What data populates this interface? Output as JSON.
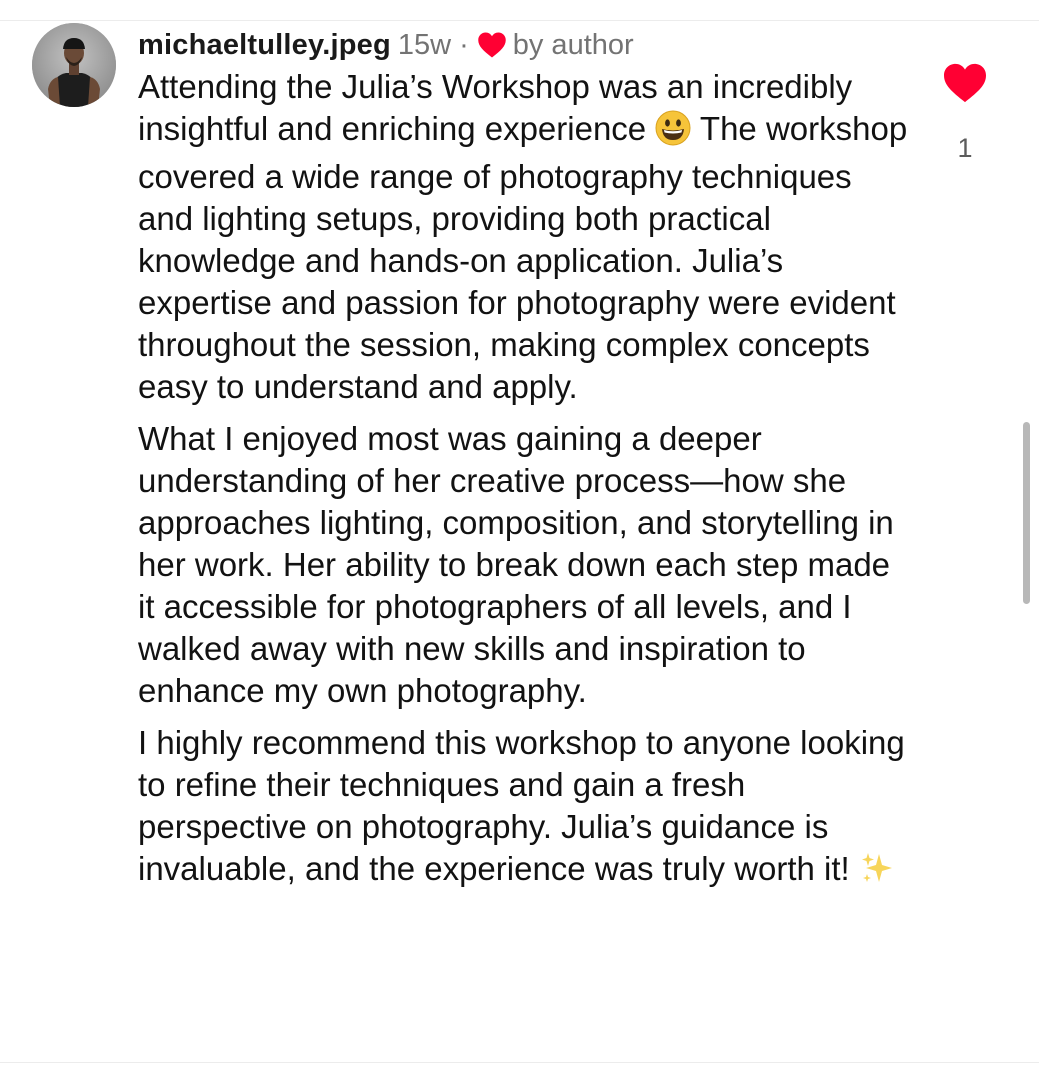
{
  "comment": {
    "username": "michaeltulley.jpeg",
    "timestamp": "15w",
    "separator": "·",
    "author_badge": "by author",
    "paragraphs": [
      {
        "before_emoji": "Attending the Julia’s Workshop was an incredibly insightful and enriching experience",
        "emoji": "grinning-face-emoji",
        "after_emoji": "The workshop covered a wide range of photography techniques and lighting setups, providing both practical knowledge and hands-on application. Julia’s expertise and passion for photography were evident throughout the session, making complex concepts easy to understand and apply."
      },
      {
        "text": "What I enjoyed most was gaining a deeper understanding of her creative process—how she approaches lighting, composition, and storytelling in her work. Her ability to break down each step made it accessible for photographers of all levels, and I walked away with new skills and inspiration to enhance my own photography."
      },
      {
        "text": "I highly recommend this workshop to anyone looking to refine their techniques and gain a fresh perspective on photography. Julia’s guidance is invaluable, and the experience was truly worth it!",
        "emoji": "sparkles-emoji"
      }
    ],
    "like_count": "1",
    "liked": true
  },
  "icons": {
    "author_heart": "heart-icon",
    "like": "heart-icon"
  },
  "colors": {
    "heart": "#ff0033",
    "meta_gray": "#737373",
    "text": "#121212",
    "emoji_yellow": "#f6c43a"
  }
}
